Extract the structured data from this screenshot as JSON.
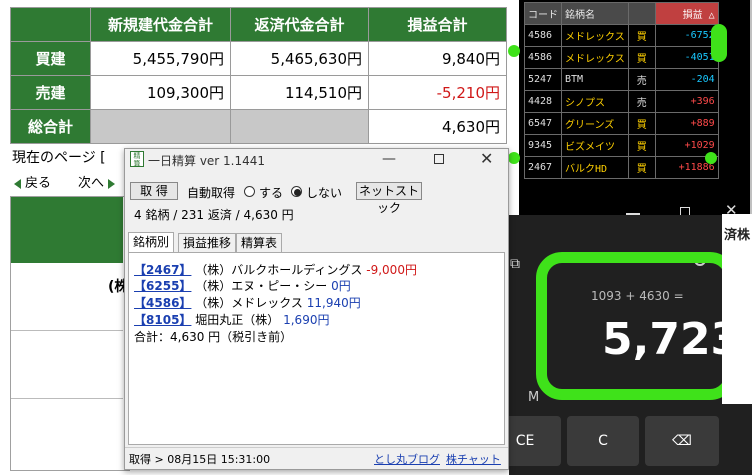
{
  "summary": {
    "headers": [
      "新規建代金合計",
      "返済代金合計",
      "損益合計"
    ],
    "rows": [
      {
        "label": "買建",
        "new": "5,455,790円",
        "close": "5,465,630円",
        "pl": "9,840円"
      },
      {
        "label": "売建",
        "new": "109,300円",
        "close": "114,510円",
        "pl": "-5,210円"
      },
      {
        "label": "総合計",
        "new": "",
        "close": "",
        "pl": "4,630円"
      }
    ]
  },
  "page": {
    "current_page_label": "現在のページ [",
    "back": "戻る",
    "next": "次へ",
    "fragment": "(株"
  },
  "stock_list": {
    "headers": {
      "code": "コード",
      "name": "銘柄名",
      "pl": "損益"
    },
    "sort_indicator": "△",
    "rows": [
      {
        "code": "4586",
        "name": "メドレックス",
        "side": "買",
        "pl": "-6752"
      },
      {
        "code": "4586",
        "name": "メドレックス",
        "side": "買",
        "pl": "-4051"
      },
      {
        "code": "5247",
        "name": "BTM",
        "side": "売",
        "pl": "-204"
      },
      {
        "code": "4428",
        "name": "シノプス",
        "side": "売",
        "pl": "+396"
      },
      {
        "code": "6547",
        "name": "グリーンズ",
        "side": "買",
        "pl": "+889"
      },
      {
        "code": "9345",
        "name": "ビズメイツ",
        "side": "買",
        "pl": "+1029"
      },
      {
        "code": "2467",
        "name": "バルクHD",
        "side": "買",
        "pl": "+11886"
      }
    ],
    "colors": {
      "negative": "#19c8ff",
      "positive": "#ff4a4a",
      "buy": "#ffd000"
    }
  },
  "calculator": {
    "expression": "1093 + 4630 =",
    "result": "5,723",
    "memory_label": "M",
    "keys": [
      "CE",
      "C",
      "⌫"
    ],
    "highlight_color": "#3fe21a"
  },
  "right_strip_text": "済株",
  "window": {
    "title": "一日精算 ver 1.1441",
    "icon_text": "精算",
    "get_button": "取 得",
    "auto_label": "自動取得",
    "radio_on": "する",
    "radio_off": "しない",
    "net_button": "ネットストック",
    "stats": "4 銘柄 / 231 返済 / 4,630 円",
    "tabs": [
      "銘柄別",
      "損益推移",
      "精算表"
    ],
    "entries": [
      {
        "code": "2467",
        "name": "（株）バルクホールディングス",
        "pl": "-9,000円"
      },
      {
        "code": "6255",
        "name": "（株）エヌ・ピー・シー",
        "pl": "0円"
      },
      {
        "code": "4586",
        "name": "（株）メドレックス",
        "pl": "11,940円"
      },
      {
        "code": "8105",
        "name": "堀田丸正（株）",
        "pl": "1,690円"
      }
    ],
    "total": "合計：4,630 円（税引き前）",
    "status": "取得 > 08月15日 15:31:00",
    "link_blog": "とし丸ブログ",
    "link_chart": "株チャット"
  }
}
